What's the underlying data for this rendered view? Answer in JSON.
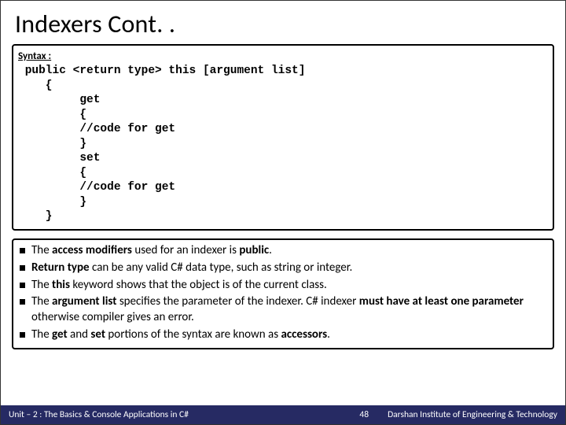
{
  "title": "Indexers Cont. .",
  "syntax": {
    "label": "Syntax :",
    "code": " public <return type> this [argument list]\n    {\n         get\n         {\n         //code for get\n         }\n         set\n         {\n         //code for get\n         }\n    }"
  },
  "bullets": [
    {
      "html": "The <b>access modifiers</b> used for an indexer is <b>public</b>."
    },
    {
      "html": "<b>Return type</b> can be any valid C# data type, such as string or integer."
    },
    {
      "html": "The <b>this</b> keyword shows that the object is of the current class."
    },
    {
      "html": "The <b>argument list</b> specifies the parameter of the indexer. C# indexer <b>must have at least one parameter</b> otherwise compiler gives an error."
    },
    {
      "html": "The <b>get</b> and <b>set</b> portions of the syntax are known as <b>accessors</b>."
    }
  ],
  "footer": {
    "left": "Unit – 2 : The Basics & Console Applications in C#",
    "page": "48",
    "right": "Darshan Institute of Engineering & Technology"
  }
}
